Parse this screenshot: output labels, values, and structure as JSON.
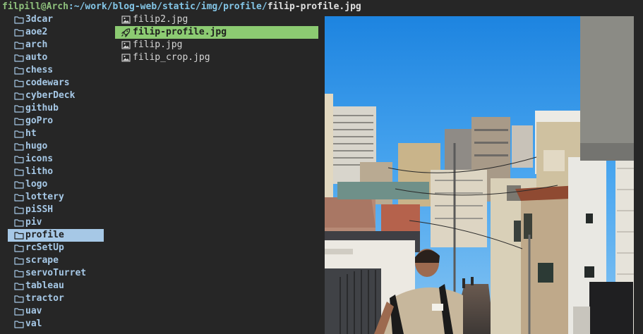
{
  "titlebar": {
    "user_host": "filpill@Arch",
    "sep": ":",
    "path": "~/work/blog-web/static/img/profile/",
    "file": "filip-profile.jpg"
  },
  "dirs": [
    {
      "label": "3dcar"
    },
    {
      "label": "aoe2"
    },
    {
      "label": "arch"
    },
    {
      "label": "auto"
    },
    {
      "label": "chess"
    },
    {
      "label": "codewars"
    },
    {
      "label": "cyberDeck"
    },
    {
      "label": "github"
    },
    {
      "label": "goPro"
    },
    {
      "label": "ht"
    },
    {
      "label": "hugo"
    },
    {
      "label": "icons"
    },
    {
      "label": "litho"
    },
    {
      "label": "logo"
    },
    {
      "label": "lottery"
    },
    {
      "label": "piSSH"
    },
    {
      "label": "piv"
    },
    {
      "label": "profile"
    },
    {
      "label": "rcSetUp"
    },
    {
      "label": "scrape"
    },
    {
      "label": "servoTurret"
    },
    {
      "label": "tableau"
    },
    {
      "label": "tractor"
    },
    {
      "label": "uav"
    },
    {
      "label": "val"
    }
  ],
  "selected_dir": "profile",
  "files": [
    {
      "label": "filip2.jpg",
      "icon": "image-icon"
    },
    {
      "label": "filip-profile.jpg",
      "icon": "rocket-icon"
    },
    {
      "label": "filip.jpg",
      "icon": "image-icon"
    },
    {
      "label": "filip_crop.jpg",
      "icon": "image-icon"
    }
  ],
  "selected_file": "filip-profile.jpg",
  "colors": {
    "dir": "#a6c8e6",
    "selected_file_bg": "#8ccb72",
    "background": "#262626"
  }
}
